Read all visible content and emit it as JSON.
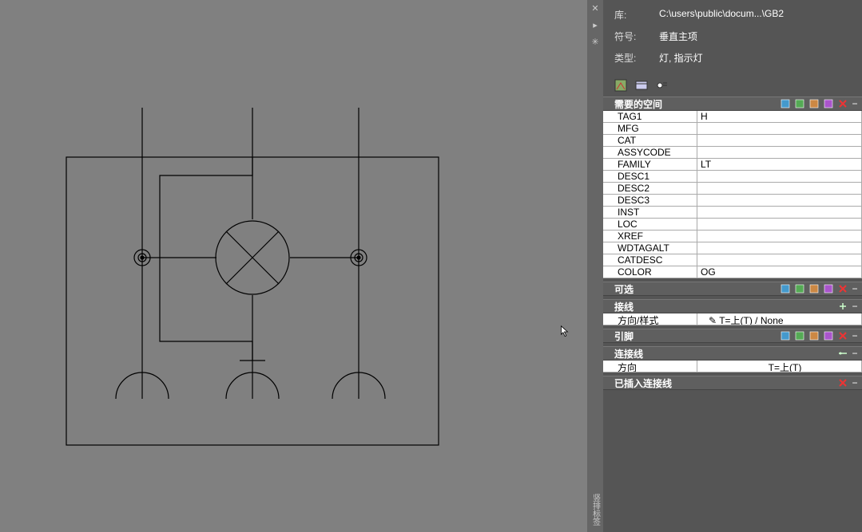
{
  "info": {
    "lib_label": "库:",
    "lib_value": "C:\\users\\public\\docum...\\GB2",
    "sym_label": "符号:",
    "sym_value": "垂直主项",
    "type_label": "类型:",
    "type_value": "灯, 指示灯"
  },
  "sections": {
    "required": {
      "title": "需要的空间",
      "rows": [
        {
          "k": "TAG1",
          "v": "H"
        },
        {
          "k": "MFG",
          "v": ""
        },
        {
          "k": "CAT",
          "v": ""
        },
        {
          "k": "ASSYCODE",
          "v": ""
        },
        {
          "k": "FAMILY",
          "v": "LT"
        },
        {
          "k": "DESC1",
          "v": ""
        },
        {
          "k": "DESC2",
          "v": ""
        },
        {
          "k": "DESC3",
          "v": ""
        },
        {
          "k": "INST",
          "v": ""
        },
        {
          "k": "LOC",
          "v": ""
        },
        {
          "k": "XREF",
          "v": ""
        },
        {
          "k": "WDTAGALT",
          "v": ""
        },
        {
          "k": "CATDESC",
          "v": ""
        },
        {
          "k": "COLOR",
          "v": "OG"
        }
      ]
    },
    "optional": {
      "title": "可选"
    },
    "wiring": {
      "title": "接线",
      "row": {
        "k": "方向/样式",
        "v": "T=上(T) / None"
      }
    },
    "pins": {
      "title": "引脚"
    },
    "connwire": {
      "title": "连接线",
      "row": {
        "k": "方向",
        "v": "T=上(T)"
      }
    },
    "inserted": {
      "title": "已插入连接线"
    }
  },
  "icons": {
    "x": "✕",
    "right": "▸",
    "settings": "✳",
    "minus": "−",
    "pencil": "✎"
  }
}
